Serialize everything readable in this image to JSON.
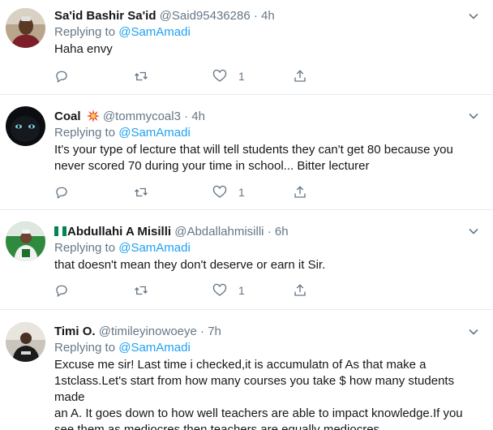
{
  "reply_prefix": "Replying to",
  "tweets": [
    {
      "name": "Sa'id Bashir Sa'id",
      "handle": "@Said95436286",
      "separator": "·",
      "time": "4h",
      "reply_to": "@SamAmadi",
      "lines": [
        "Haha envy"
      ],
      "likes": "1",
      "badge": ""
    },
    {
      "name": "Coal",
      "handle": "@tommycoal3",
      "separator": "·",
      "time": "4h",
      "reply_to": "@SamAmadi",
      "lines": [
        "It's your type of lecture that will tell students they can't get 80 because you",
        "never scored 70 during your time in school... Bitter lecturer"
      ],
      "likes": "1",
      "badge": "explosion-emoji"
    },
    {
      "name": "Abdullahi A Misilli",
      "handle": "@Abdallahmisilli",
      "separator": "·",
      "time": "6h",
      "reply_to": "@SamAmadi",
      "lines": [
        "that doesn't mean they don't deserve or earn it Sir."
      ],
      "likes": "1",
      "badge": "nigeria-flag-emoji"
    },
    {
      "name": "Timi O.",
      "handle": "@timileyinowoeye",
      "separator": "·",
      "time": "7h",
      "reply_to": "@SamAmadi",
      "lines": [
        "Excuse me sir! Last time i checked,it is accumulatn of As that make a",
        "1stclass.Let's start from how many courses you take $ how many students made",
        "an A. It goes down to how well teachers are able to impact knowledge.If you",
        "see them as mediocres,then teachers are equally mediocres"
      ],
      "likes": "",
      "badge": ""
    }
  ],
  "colors": {
    "link": "#1da1f2",
    "muted": "#657786",
    "text": "#14171a",
    "divider": "#e6ecf0"
  }
}
